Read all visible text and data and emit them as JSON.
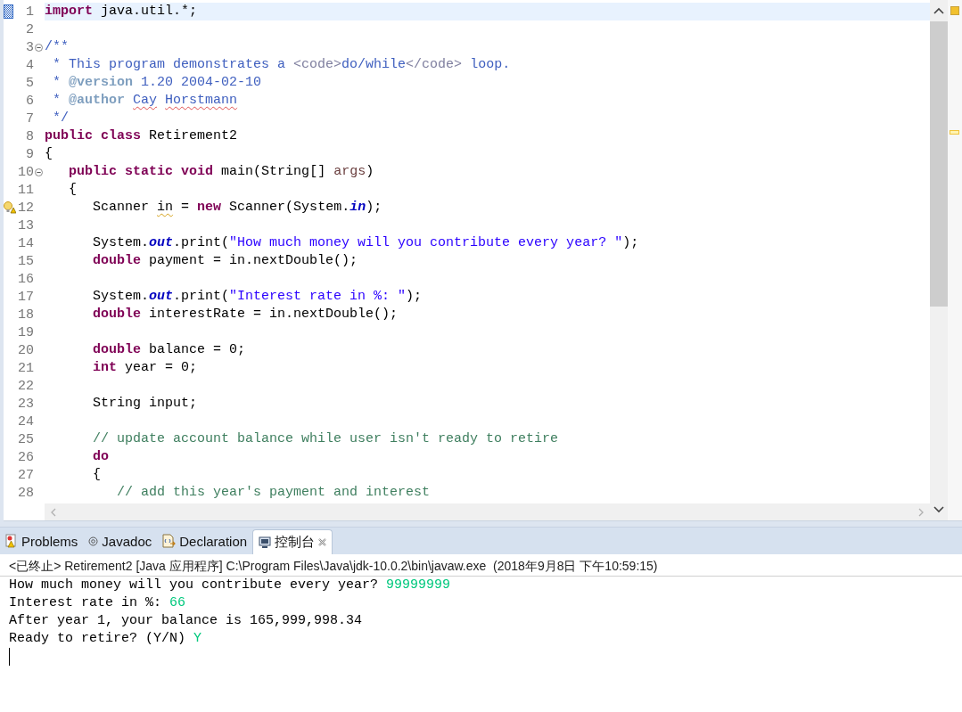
{
  "editor": {
    "lines": [
      {
        "number": "1",
        "kind": "bookmark",
        "fold": false,
        "current": true,
        "tokens": [
          {
            "kind": "kw",
            "text": "import"
          },
          {
            "kind": "text",
            "text": " java.util.*;"
          }
        ]
      },
      {
        "number": "2",
        "kind": "plain",
        "fold": false,
        "current": false
      },
      {
        "number": "3",
        "kind": "plain",
        "fold": true,
        "current": false,
        "tokens": [
          {
            "kind": "doc",
            "text": "/**"
          }
        ]
      },
      {
        "number": "4",
        "kind": "plain",
        "fold": false,
        "current": false,
        "tokens": [
          {
            "kind": "doc",
            "text": " * This program demonstrates a "
          },
          {
            "kind": "html",
            "text": "<code>"
          },
          {
            "kind": "doc",
            "text": "do/while"
          },
          {
            "kind": "html",
            "text": "</code>"
          },
          {
            "kind": "doc",
            "text": " loop."
          }
        ]
      },
      {
        "number": "5",
        "kind": "plain",
        "fold": false,
        "current": false,
        "tokens": [
          {
            "kind": "doc",
            "text": " * "
          },
          {
            "kind": "doctag",
            "text": "@version"
          },
          {
            "kind": "doc",
            "text": " 1.20 2004-02-10"
          }
        ]
      },
      {
        "number": "6",
        "kind": "plain",
        "fold": false,
        "current": false,
        "tokens": [
          {
            "kind": "doc",
            "text": " * "
          },
          {
            "kind": "doctag",
            "text": "@author"
          },
          {
            "kind": "doc-misspelled",
            "text": " Cay"
          },
          {
            "kind": "doc-misspelled",
            "text": " Horstmann"
          }
        ]
      },
      {
        "number": "7",
        "kind": "plain",
        "fold": false,
        "current": false,
        "tokens": [
          {
            "kind": "doc",
            "text": " */"
          }
        ]
      },
      {
        "number": "8",
        "kind": "plain",
        "fold": false,
        "current": false,
        "tokens": [
          {
            "kind": "kw",
            "text": "public"
          },
          {
            "kind": "kw",
            "text": " class"
          },
          {
            "kind": "text",
            "text": " Retirement2"
          }
        ]
      },
      {
        "number": "9",
        "kind": "plain",
        "fold": false,
        "current": false,
        "tokens": [
          {
            "kind": "text",
            "text": "{"
          }
        ]
      },
      {
        "number": "10",
        "kind": "plain",
        "fold": true,
        "current": false,
        "tokens": [
          {
            "kind": "kw",
            "text": "   public"
          },
          {
            "kind": "kw",
            "text": " static"
          },
          {
            "kind": "kw",
            "text": " void"
          },
          {
            "kind": "text",
            "text": " main(String[] "
          },
          {
            "kind": "param",
            "text": "args"
          },
          {
            "kind": "text",
            "text": ")"
          }
        ]
      },
      {
        "number": "11",
        "kind": "plain",
        "fold": false,
        "current": false,
        "tokens": [
          {
            "kind": "text",
            "text": "   {"
          }
        ]
      },
      {
        "number": "12",
        "kind": "warning",
        "fold": false,
        "current": false,
        "tokens": [
          {
            "kind": "text",
            "text": "      Scanner "
          },
          {
            "kind": "warned",
            "text": "in"
          },
          {
            "kind": "text",
            "text": " = "
          },
          {
            "kind": "kw",
            "text": "new"
          },
          {
            "kind": "text",
            "text": " Scanner(System."
          },
          {
            "kind": "field",
            "text": "in"
          },
          {
            "kind": "text",
            "text": ");"
          }
        ]
      },
      {
        "number": "13",
        "kind": "plain",
        "fold": false,
        "current": false
      },
      {
        "number": "14",
        "kind": "plain",
        "fold": false,
        "current": false,
        "tokens": [
          {
            "kind": "text",
            "text": "      System."
          },
          {
            "kind": "field",
            "text": "out"
          },
          {
            "kind": "text",
            "text": ".print("
          },
          {
            "kind": "string",
            "text": "\"How much money will you contribute every year? \""
          },
          {
            "kind": "text",
            "text": ");"
          }
        ]
      },
      {
        "number": "15",
        "kind": "plain",
        "fold": false,
        "current": false,
        "tokens": [
          {
            "kind": "kw",
            "text": "      double"
          },
          {
            "kind": "text",
            "text": " payment = in.nextDouble();"
          }
        ]
      },
      {
        "number": "16",
        "kind": "plain",
        "fold": false,
        "current": false
      },
      {
        "number": "17",
        "kind": "plain",
        "fold": false,
        "current": false,
        "tokens": [
          {
            "kind": "text",
            "text": "      System."
          },
          {
            "kind": "field",
            "text": "out"
          },
          {
            "kind": "text",
            "text": ".print("
          },
          {
            "kind": "string",
            "text": "\"Interest rate in %: \""
          },
          {
            "kind": "text",
            "text": ");"
          }
        ]
      },
      {
        "number": "18",
        "kind": "plain",
        "fold": false,
        "current": false,
        "tokens": [
          {
            "kind": "kw",
            "text": "      double"
          },
          {
            "kind": "text",
            "text": " interestRate = in.nextDouble();"
          }
        ]
      },
      {
        "number": "19",
        "kind": "plain",
        "fold": false,
        "current": false
      },
      {
        "number": "20",
        "kind": "plain",
        "fold": false,
        "current": false,
        "tokens": [
          {
            "kind": "kw",
            "text": "      double"
          },
          {
            "kind": "text",
            "text": " balance = 0;"
          }
        ]
      },
      {
        "number": "21",
        "kind": "plain",
        "fold": false,
        "current": false,
        "tokens": [
          {
            "kind": "kw",
            "text": "      int"
          },
          {
            "kind": "text",
            "text": " year = 0;"
          }
        ]
      },
      {
        "number": "22",
        "kind": "plain",
        "fold": false,
        "current": false
      },
      {
        "number": "23",
        "kind": "plain",
        "fold": false,
        "current": false,
        "tokens": [
          {
            "kind": "text",
            "text": "      String input;"
          }
        ]
      },
      {
        "number": "24",
        "kind": "plain",
        "fold": false,
        "current": false
      },
      {
        "number": "25",
        "kind": "plain",
        "fold": false,
        "current": false,
        "tokens": [
          {
            "kind": "comment",
            "text": "      // update account balance while user isn't ready to retire"
          }
        ]
      },
      {
        "number": "26",
        "kind": "plain",
        "fold": false,
        "current": false,
        "tokens": [
          {
            "kind": "kw",
            "text": "      do"
          }
        ]
      },
      {
        "number": "27",
        "kind": "plain",
        "fold": false,
        "current": false,
        "tokens": [
          {
            "kind": "text",
            "text": "      {"
          }
        ]
      },
      {
        "number": "28",
        "kind": "plain",
        "fold": false,
        "current": false,
        "tokens": [
          {
            "kind": "comment",
            "text": "         // add this year's payment and interest"
          }
        ]
      }
    ]
  },
  "tabs": [
    {
      "label": "Problems",
      "selected": false,
      "closable": false
    },
    {
      "label": "Javadoc",
      "selected": false,
      "closable": false
    },
    {
      "label": "Declaration",
      "selected": false,
      "closable": false
    },
    {
      "label": "控制台",
      "selected": true,
      "closable": true
    }
  ],
  "console": {
    "header": "<已终止> Retirement2 [Java 应用程序] C:\\Program Files\\Java\\jdk-10.0.2\\bin\\javaw.exe  (2018年9月8日 下午10:59:15)",
    "lines": [
      [
        {
          "kind": "output",
          "text": "How much money will you contribute every year? "
        },
        {
          "kind": "input",
          "text": "99999999"
        }
      ],
      [
        {
          "kind": "output",
          "text": "Interest rate in %: "
        },
        {
          "kind": "input",
          "text": "66"
        }
      ],
      [
        {
          "kind": "output",
          "text": "After year 1, your balance is 165,999,998.34"
        }
      ],
      [
        {
          "kind": "output",
          "text": "Ready to retire? (Y/N) "
        },
        {
          "kind": "input",
          "text": "Y"
        }
      ]
    ]
  }
}
